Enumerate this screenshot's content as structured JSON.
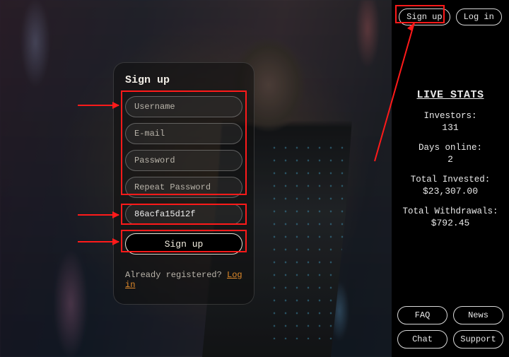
{
  "topbar": {
    "signup": "Sign up",
    "login": "Log in"
  },
  "stats": {
    "heading": "LIVE STATS",
    "investors_label": "Investors:",
    "investors_value": "131",
    "days_label": "Days online:",
    "days_value": "2",
    "invested_label": "Total Invested:",
    "invested_value": "$23,307.00",
    "withdrawals_label": "Total Withdrawals:",
    "withdrawals_value": "$792.45"
  },
  "footer_buttons": {
    "faq": "FAQ",
    "news": "News",
    "chat": "Chat",
    "support": "Support"
  },
  "form": {
    "title": "Sign up",
    "username_ph": "Username",
    "email_ph": "E-mail",
    "password_ph": "Password",
    "repeat_ph": "Repeat Password",
    "captcha_value": "86acfa15d12f",
    "submit": "Sign up",
    "already": "Already registered? ",
    "login_link": "Log in"
  }
}
